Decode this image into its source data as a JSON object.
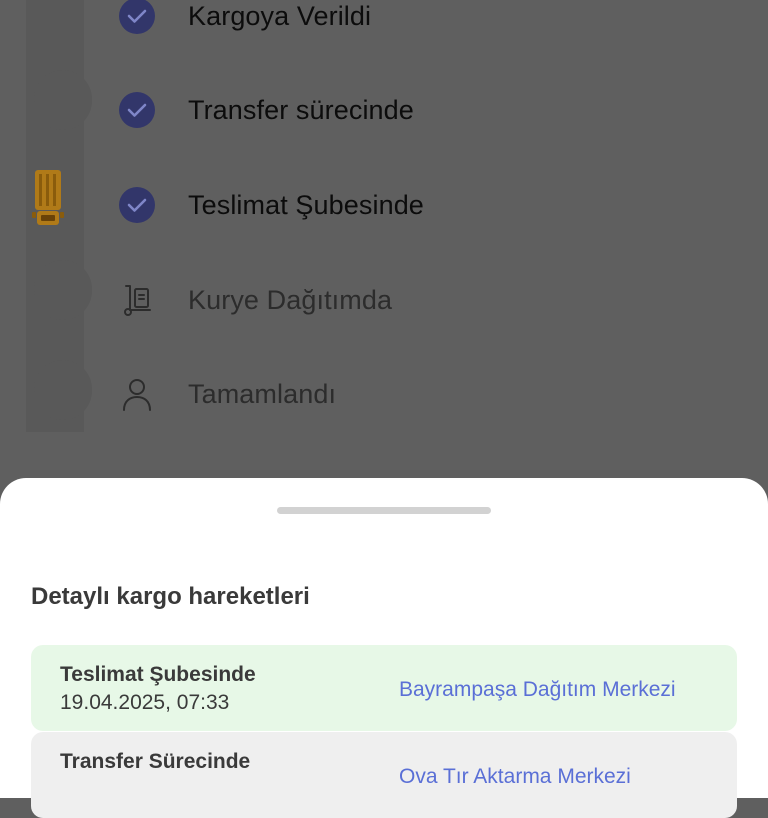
{
  "steps": [
    {
      "label": "Kargoya Verildi",
      "state": "done",
      "icon": "check-icon"
    },
    {
      "label": "Transfer sürecinde",
      "state": "done",
      "icon": "check-icon"
    },
    {
      "label": "Teslimat Şubesinde",
      "state": "done",
      "icon": "check-icon"
    },
    {
      "label": "Kurye Dağıtımda",
      "state": "pending",
      "icon": "courier-cart-icon"
    },
    {
      "label": "Tamamlandı",
      "state": "pending",
      "icon": "person-icon"
    }
  ],
  "sheet": {
    "title": "Detaylı kargo hareketleri",
    "movements": [
      {
        "status": "Teslimat Şubesinde",
        "datetime": "19.04.2025, 07:33",
        "location": "Bayrampaşa Dağıtım Merkezi"
      },
      {
        "status": "Transfer Sürecinde",
        "datetime": "",
        "location": "Ova Tır Aktarma Merkezi"
      }
    ]
  },
  "colors": {
    "accent": "#5a6fd6",
    "active_row": "#e7f8e7",
    "truck": "#c8860f"
  }
}
